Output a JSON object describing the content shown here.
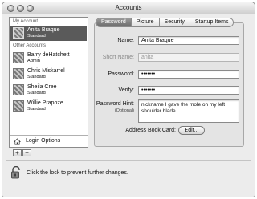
{
  "window": {
    "title": "Accounts"
  },
  "sidebar": {
    "my_account_header": "My Account",
    "other_accounts_header": "Other Accounts",
    "my_account": {
      "name": "Anita Braque",
      "role": "Standard"
    },
    "accounts": [
      {
        "name": "Barry deHatchett",
        "role": "Admin"
      },
      {
        "name": "Chris Miskarrel",
        "role": "Standard"
      },
      {
        "name": "Sheila Cree",
        "role": "Standard"
      },
      {
        "name": "Willie Prapoze",
        "role": "Standard"
      }
    ],
    "login_options": "Login Options",
    "add_label": "+",
    "remove_label": "−"
  },
  "tabs": [
    "Password",
    "Picture",
    "Security",
    "Startup Items"
  ],
  "active_tab": "Password",
  "form": {
    "name_label": "Name:",
    "name_value": "Anita Braque",
    "short_name_label": "Short Name:",
    "short_name_value": "anita",
    "password_label": "Password:",
    "password_value": "•••••••",
    "verify_label": "Verify:",
    "verify_value": "•••••••",
    "hint_label": "Password Hint:",
    "hint_optional": "(Optional)",
    "hint_value": "nickname I gave the mole on my left shoulder blade",
    "address_book_label": "Address Book Card:",
    "edit_button": "Edit..."
  },
  "footer": {
    "lock_text": "Click the lock to prevent further changes."
  }
}
